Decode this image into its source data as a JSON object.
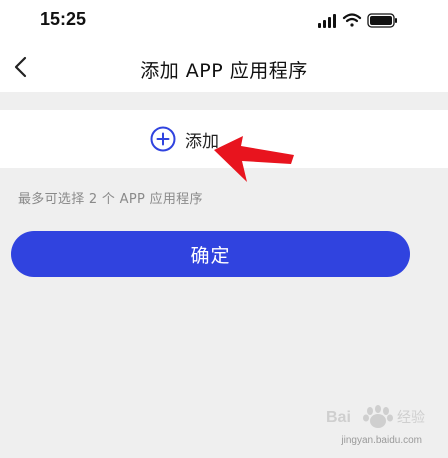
{
  "status_bar": {
    "time": "15:25"
  },
  "nav": {
    "title": "添加 APP 应用程序"
  },
  "add_row": {
    "label": "添加"
  },
  "hint": "最多可选择 2 个 APP 应用程序",
  "confirm_label": "确定",
  "watermark": {
    "sub": "jingyan.baidu.com"
  },
  "colors": {
    "accent": "#3043df",
    "arrow": "#e8141e",
    "background": "#efefef"
  },
  "icons": [
    "signal-icon",
    "wifi-icon",
    "battery-icon",
    "back-arrow-icon",
    "plus-circle-icon",
    "red-arrow-icon",
    "baidu-watermark-icon"
  ]
}
